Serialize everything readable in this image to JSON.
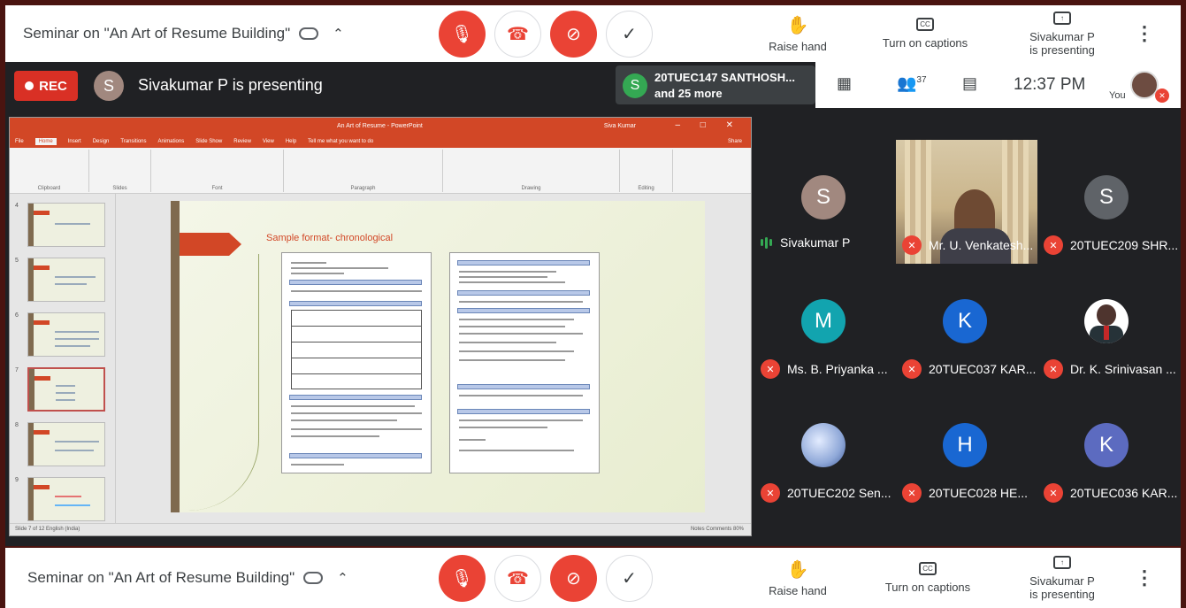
{
  "meeting": {
    "title": "Seminar on \"An Art of Resume Building\"",
    "raise_hand": "Raise hand",
    "captions": "Turn on captions",
    "presenting_line1": "Sivakumar P",
    "presenting_line2": "is presenting"
  },
  "topbar": {
    "rec_label": "REC",
    "presenter_initial": "S",
    "presenter_text": "Sivakumar P is presenting",
    "speaker_initial": "S",
    "speaker_line1": "20TUEC147 SANTHOSH...",
    "speaker_line2": "and 25 more",
    "participant_count": "37",
    "clock": "12:37 PM",
    "you_label": "You"
  },
  "powerpoint": {
    "window_title": "An Art of Resume - PowerPoint",
    "user": "Siva Kumar",
    "tabs": [
      "File",
      "Home",
      "Insert",
      "Design",
      "Transitions",
      "Animations",
      "Slide Show",
      "Review",
      "View",
      "Help",
      "Tell me what you want to do"
    ],
    "share_label": "Share",
    "ribbon_groups": [
      "Clipboard",
      "Slides",
      "Font",
      "Paragraph",
      "Drawing",
      "Editing"
    ],
    "slide_numbers": [
      "4",
      "5",
      "6",
      "7",
      "8",
      "9"
    ],
    "slide_heading": "Sample format- chronological",
    "status_left": "Slide 7 of 12    English (India)",
    "status_right": "Notes   Comments   80%"
  },
  "participants": [
    {
      "name": "Sivakumar P",
      "initial": "S",
      "color": "#a1887f",
      "muted": false
    },
    {
      "name": "Mr. U. Venkatesh...",
      "initial": "",
      "color": "",
      "muted": true,
      "video": true
    },
    {
      "name": "20TUEC209 SHR...",
      "initial": "S",
      "color": "#5f6368",
      "muted": true
    },
    {
      "name": "Ms. B. Priyanka ...",
      "initial": "M",
      "color": "#12a4af",
      "muted": true
    },
    {
      "name": "20TUEC037 KAR...",
      "initial": "K",
      "color": "#1967d2",
      "muted": true
    },
    {
      "name": "Dr. K. Srinivasan ...",
      "initial": "",
      "color": "#ffffff",
      "muted": true,
      "photo": true
    },
    {
      "name": "20TUEC202 Sen...",
      "initial": "",
      "color": "#8fa8d8",
      "muted": true,
      "photo": true
    },
    {
      "name": "20TUEC028 HE...",
      "initial": "H",
      "color": "#1967d2",
      "muted": true
    },
    {
      "name": "20TUEC036 KAR...",
      "initial": "K",
      "color": "#5c6bc0",
      "muted": true
    }
  ]
}
